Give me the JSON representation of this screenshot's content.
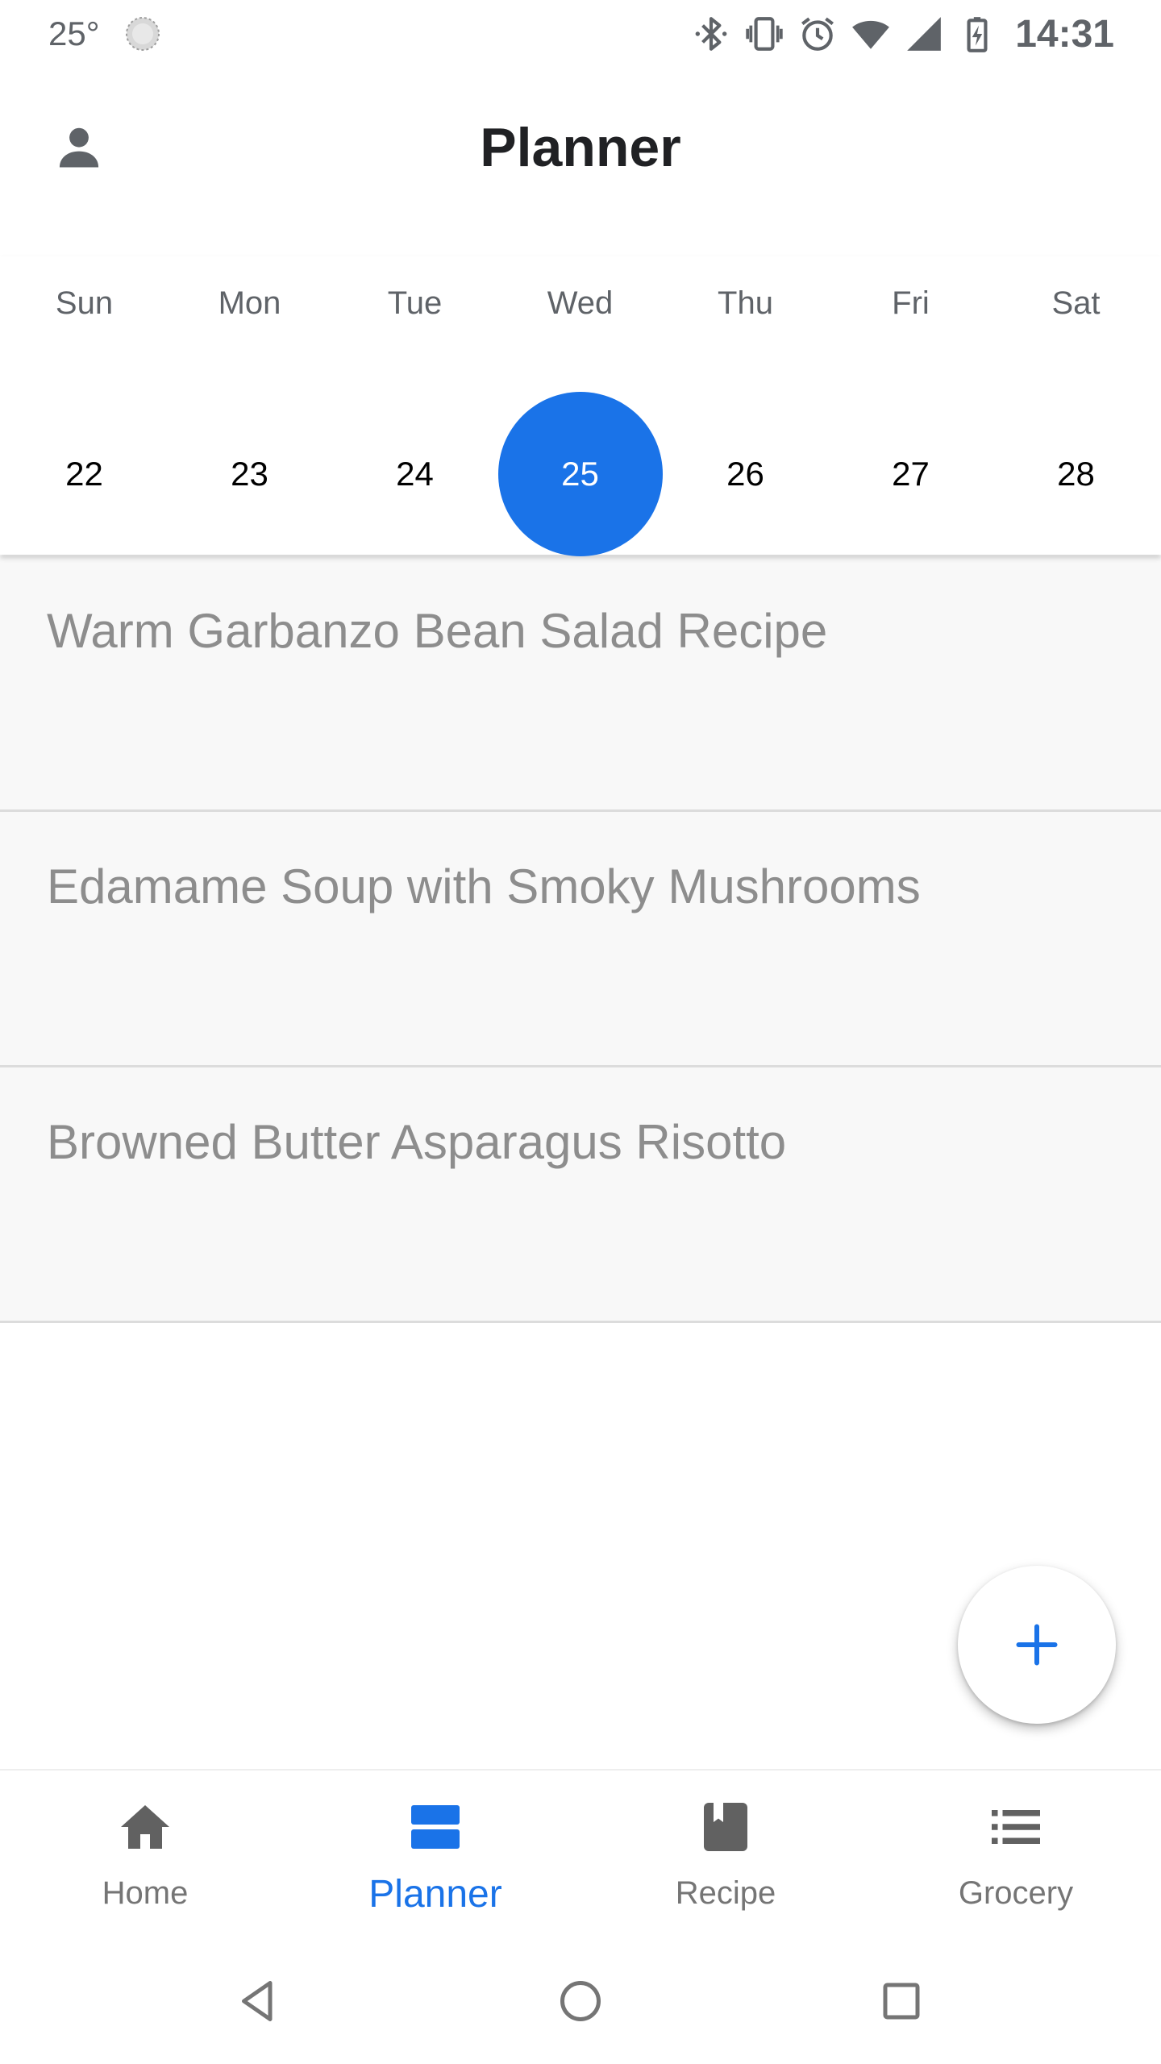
{
  "status_bar": {
    "temperature": "25°",
    "time": "14:31",
    "icons": [
      "weather-icon",
      "bluetooth-icon",
      "vibrate-icon",
      "alarm-icon",
      "wifi-icon",
      "signal-icon",
      "battery-icon"
    ]
  },
  "header": {
    "title": "Planner",
    "profile_icon": "person-icon"
  },
  "calendar": {
    "day_names": [
      "Sun",
      "Mon",
      "Tue",
      "Wed",
      "Thu",
      "Fri",
      "Sat"
    ],
    "day_numbers": [
      "22",
      "23",
      "24",
      "25",
      "26",
      "27",
      "28"
    ],
    "selected_day": "25"
  },
  "meals": [
    {
      "title": "Warm Garbanzo Bean Salad Recipe"
    },
    {
      "title": "Edamame Soup with Smoky Mushrooms"
    },
    {
      "title": "Browned Butter Asparagus Risotto"
    }
  ],
  "fab": {
    "icon": "plus-icon"
  },
  "bottom_nav": {
    "items": [
      {
        "label": "Home",
        "icon": "home-icon",
        "active": false
      },
      {
        "label": "Planner",
        "icon": "planner-icon",
        "active": true
      },
      {
        "label": "Recipe",
        "icon": "book-icon",
        "active": false
      },
      {
        "label": "Grocery",
        "icon": "list-icon",
        "active": false
      }
    ]
  },
  "system_nav": {
    "icons": [
      "back-icon",
      "home-circle-icon",
      "recents-icon"
    ]
  },
  "colors": {
    "accent": "#1a73e8",
    "title_text": "#202124",
    "meal_text": "#8d8d8d",
    "meal_background": "#f8f8f8",
    "inactive_nav": "#757575"
  }
}
